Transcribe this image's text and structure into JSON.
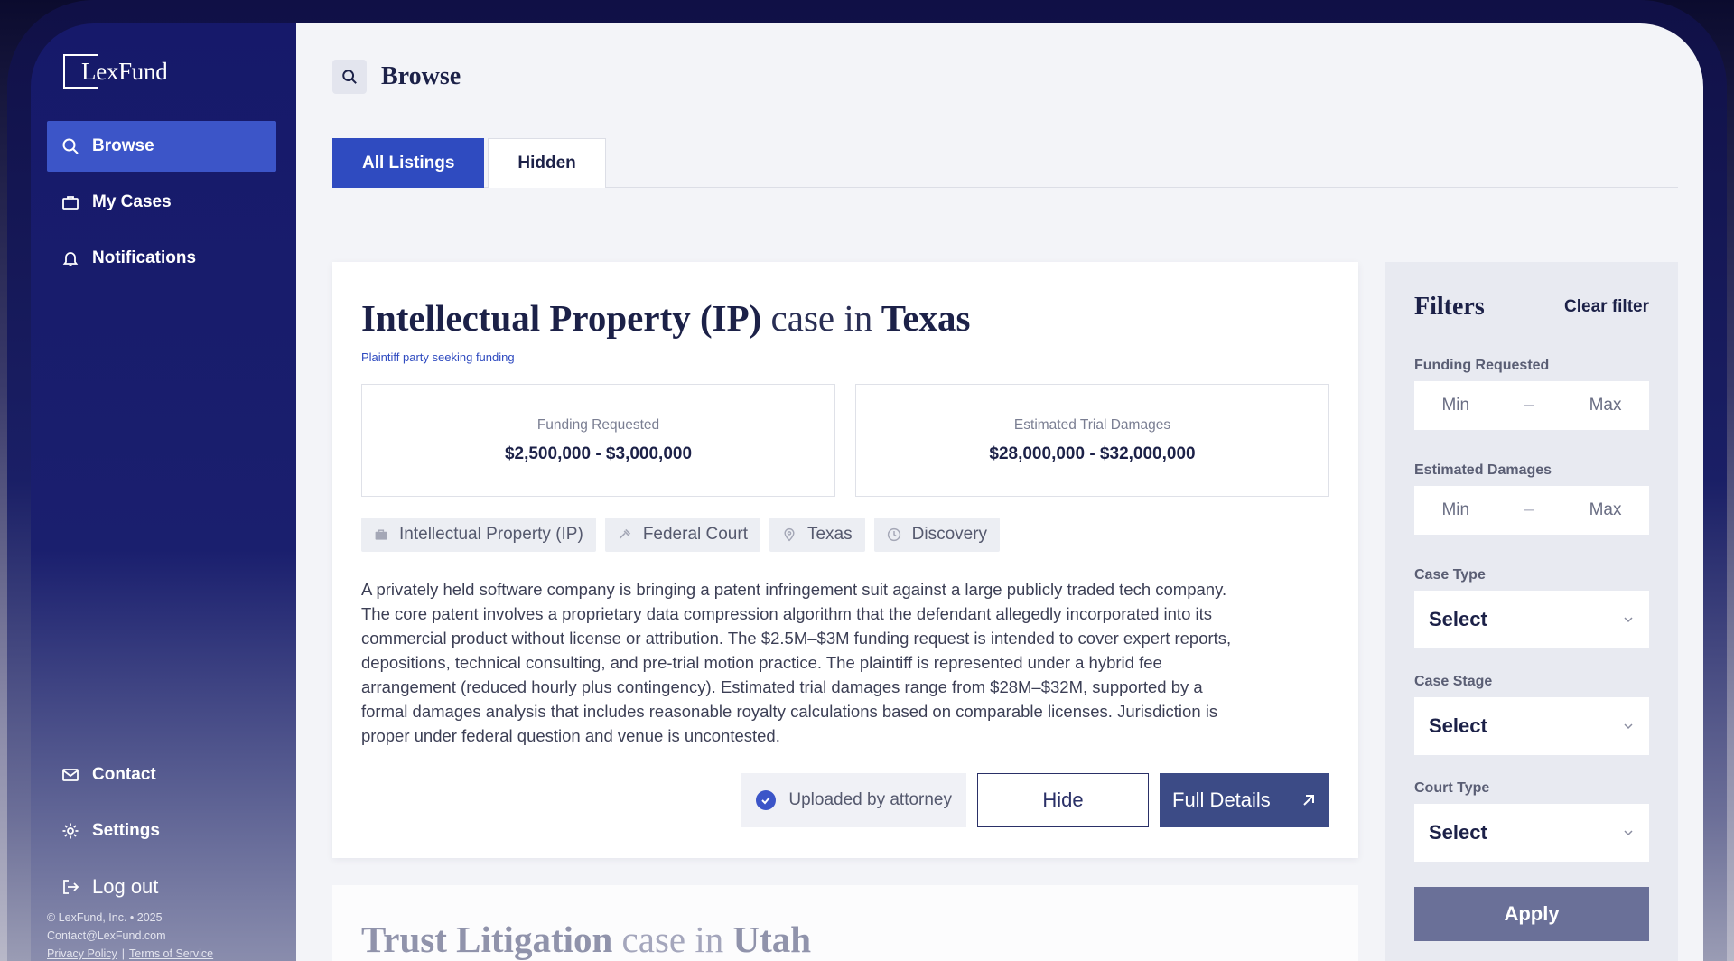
{
  "app": {
    "logo_text": "LexFund"
  },
  "sidebar": {
    "items": [
      {
        "label": "Browse",
        "icon": "search-icon",
        "active": true
      },
      {
        "label": "My Cases",
        "icon": "briefcase-icon"
      },
      {
        "label": "Notifications",
        "icon": "bell-icon"
      }
    ],
    "bottom_items": [
      {
        "label": "Contact",
        "icon": "mail-icon"
      },
      {
        "label": "Settings",
        "icon": "gear-icon"
      },
      {
        "label": "Log out",
        "icon": "logout-icon"
      }
    ],
    "footer": {
      "copyright": "© LexFund, Inc. • 2025",
      "email": "Contact@LexFund.com",
      "privacy": "Privacy Policy",
      "terms": "Terms of Service"
    }
  },
  "header": {
    "title": "Browse"
  },
  "tabs": [
    {
      "label": "All Listings",
      "active": true
    },
    {
      "label": "Hidden"
    }
  ],
  "listing": {
    "title_type": "Intellectual Property (IP)",
    "title_mid": "case in",
    "title_state": "Texas",
    "subtitle": "Plaintiff party seeking funding",
    "funding_label": "Funding Requested",
    "funding_value": "$2,500,000 - $3,000,000",
    "damages_label": "Estimated Trial Damages",
    "damages_value": "$28,000,000 - $32,000,000",
    "chips": [
      {
        "label": "Intellectual Property (IP)",
        "icon": "briefcase-icon"
      },
      {
        "label": "Federal Court",
        "icon": "gavel-icon"
      },
      {
        "label": "Texas",
        "icon": "location-icon"
      },
      {
        "label": "Discovery",
        "icon": "clock-icon"
      }
    ],
    "description_lines": [
      "A privately held software company is bringing a patent infringement suit against a large publicly traded tech company.",
      "The core patent involves a proprietary data compression algorithm that the defendant allegedly incorporated into its",
      "commercial product without license or attribution. The $2.5M–$3M funding request is intended to cover expert reports,",
      "depositions, technical consulting, and pre-trial motion practice. The plaintiff is represented under a hybrid fee",
      "arrangement (reduced hourly plus contingency). Estimated trial damages range from $28M–$32M, supported by a",
      "formal damages analysis that includes reasonable royalty calculations based on comparable licenses. Jurisdiction is",
      "proper under federal question and venue is uncontested."
    ],
    "verified_label": "Uploaded by attorney",
    "hide_label": "Hide",
    "details_label": "Full Details"
  },
  "listing2": {
    "title_type": "Trust Litigation",
    "title_mid": "case in",
    "title_state": "Utah"
  },
  "filters": {
    "title": "Filters",
    "clear_label": "Clear filter",
    "funding_label": "Funding Requested",
    "damages_label": "Estimated Damages",
    "min_placeholder": "Min",
    "max_placeholder": "Max",
    "dash": "–",
    "case_type_label": "Case Type",
    "case_stage_label": "Case Stage",
    "court_type_label": "Court Type",
    "select_value": "Select",
    "apply_label": "Apply"
  },
  "colors": {
    "accent": "#3c55c8",
    "sidebar": "#1a1f6e",
    "details_button": "#3c4b86",
    "apply_button": "#6a7098"
  }
}
